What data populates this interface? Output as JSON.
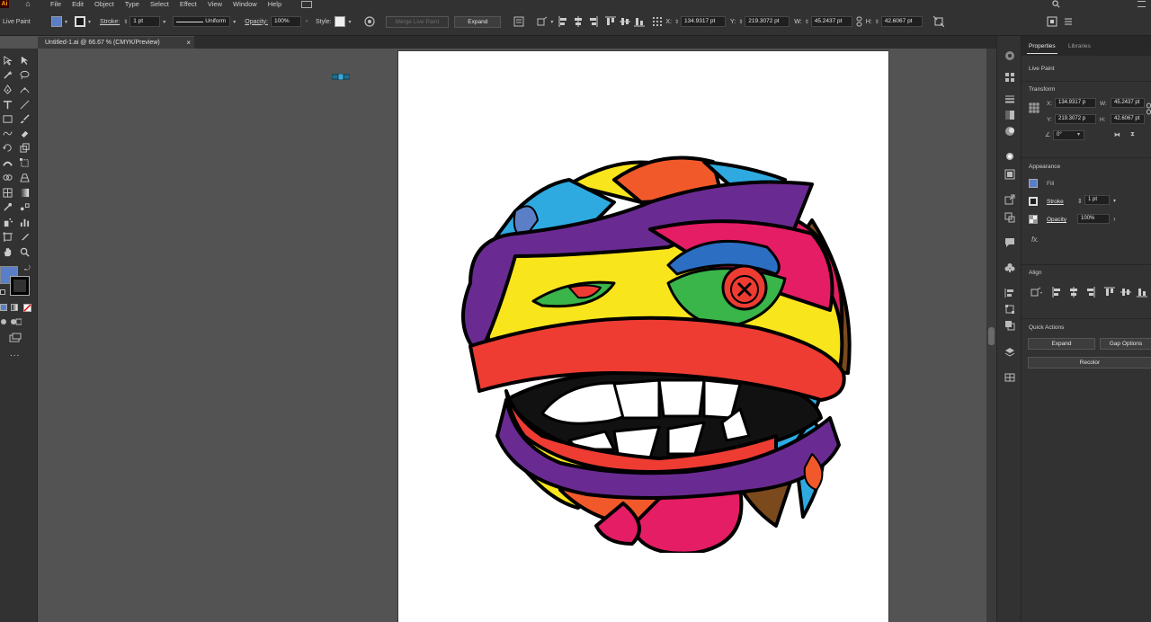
{
  "menubar": {
    "logo": "Ai",
    "items": [
      "File",
      "Edit",
      "Object",
      "Type",
      "Select",
      "Effect",
      "View",
      "Window",
      "Help"
    ]
  },
  "control_bar": {
    "mode_label": "Live Paint",
    "stroke_label": "Stroke:",
    "stroke_value": "1 pt",
    "profile_label": "Uniform",
    "opacity_label": "Opacity:",
    "opacity_value": "100%",
    "style_label": "Style:",
    "merge_button": "Merge Live Paint",
    "expand_button": "Expand",
    "x_label": "X:",
    "x_value": "134.9317 pt",
    "y_label": "Y:",
    "y_value": "219.3072 pt",
    "w_label": "W:",
    "w_value": "45.2437 pt",
    "h_label": "H:",
    "h_value": "42.6067 pt",
    "fill_color": "#5a7fc6"
  },
  "document": {
    "tab_title": "Untitled-1.ai @ 66.67 % (CMYK/Preview)",
    "close_symbol": "×"
  },
  "toolbar": {
    "fill_color": "#5a7fc6",
    "stroke_color": "#000000",
    "more": "..."
  },
  "panel": {
    "tabs": [
      "Properties",
      "Libraries"
    ],
    "object_type": "Live Paint",
    "transform": {
      "title": "Transform",
      "x_label": "X:",
      "x": "134.9317 p",
      "y_label": "Y:",
      "y": "219.3072 p",
      "w_label": "W:",
      "w": "45.2437 pt",
      "h_label": "H:",
      "h": "42.6067 pt",
      "angle": "0°"
    },
    "appearance": {
      "title": "Appearance",
      "fill_label": "Fill",
      "stroke_label": "Stroke",
      "stroke_value": "1 pt",
      "opacity_label": "Opacity",
      "opacity_value": "100%",
      "fx": "fx."
    },
    "align": {
      "title": "Align"
    },
    "quick_actions": {
      "title": "Quick Actions",
      "expand": "Expand",
      "gap_options": "Gap Options",
      "recolor": "Recolor"
    }
  }
}
